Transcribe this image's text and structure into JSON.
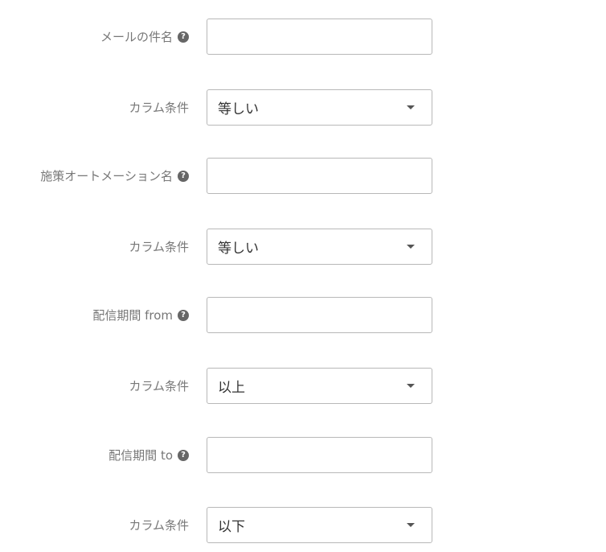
{
  "form": {
    "fields": [
      {
        "label": "メールの件名",
        "value": ""
      },
      {
        "label": "カラム条件",
        "value": "等しい"
      },
      {
        "label": "施策オートメーション名",
        "value": ""
      },
      {
        "label": "カラム条件",
        "value": "等しい"
      },
      {
        "label": "配信期間 from",
        "value": ""
      },
      {
        "label": "カラム条件",
        "value": "以上"
      },
      {
        "label": "配信期間 to",
        "value": ""
      },
      {
        "label": "カラム条件",
        "value": "以下"
      }
    ],
    "help_glyph": "?"
  }
}
